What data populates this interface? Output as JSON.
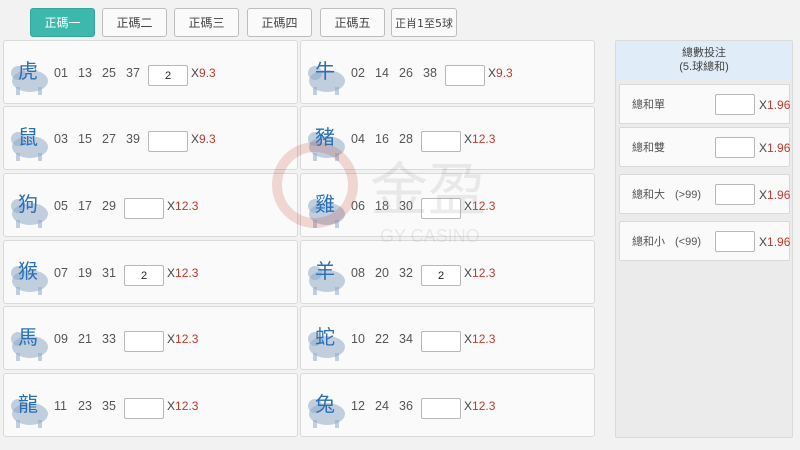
{
  "tabs": [
    {
      "label": "正碼一",
      "active": true
    },
    {
      "label": "正碼二",
      "active": false
    },
    {
      "label": "正碼三",
      "active": false
    },
    {
      "label": "正碼四",
      "active": false
    },
    {
      "label": "正碼五",
      "active": false
    },
    {
      "label": "正肖1至5球",
      "active": false
    }
  ],
  "left_column": [
    {
      "animal": "虎",
      "icon": "tiger-icon",
      "numbers": [
        "01",
        "13",
        "25",
        "37"
      ],
      "bet": "2",
      "odds_prefix": "X",
      "odds": "9.3"
    },
    {
      "animal": "鼠",
      "icon": "rat-icon",
      "numbers": [
        "03",
        "15",
        "27",
        "39"
      ],
      "bet": "",
      "odds_prefix": "X",
      "odds": "9.3"
    },
    {
      "animal": "狗",
      "icon": "dog-icon",
      "numbers": [
        "05",
        "17",
        "29"
      ],
      "bet": "",
      "odds_prefix": "X",
      "odds": "12.3"
    },
    {
      "animal": "猴",
      "icon": "monkey-icon",
      "numbers": [
        "07",
        "19",
        "31"
      ],
      "bet": "2",
      "odds_prefix": "X",
      "odds": "12.3"
    },
    {
      "animal": "馬",
      "icon": "horse-icon",
      "numbers": [
        "09",
        "21",
        "33"
      ],
      "bet": "",
      "odds_prefix": "X",
      "odds": "12.3"
    },
    {
      "animal": "龍",
      "icon": "dragon-icon",
      "numbers": [
        "11",
        "23",
        "35"
      ],
      "bet": "",
      "odds_prefix": "X",
      "odds": "12.3"
    }
  ],
  "right_column": [
    {
      "animal": "牛",
      "icon": "ox-icon",
      "numbers": [
        "02",
        "14",
        "26",
        "38"
      ],
      "bet": "",
      "odds_prefix": "X",
      "odds": "9.3"
    },
    {
      "animal": "豬",
      "icon": "pig-icon",
      "numbers": [
        "04",
        "16",
        "28"
      ],
      "bet": "",
      "odds_prefix": "X",
      "odds": "12.3"
    },
    {
      "animal": "雞",
      "icon": "rooster-icon",
      "numbers": [
        "06",
        "18",
        "30"
      ],
      "bet": "",
      "odds_prefix": "X",
      "odds": "12.3"
    },
    {
      "animal": "羊",
      "icon": "goat-icon",
      "numbers": [
        "08",
        "20",
        "32"
      ],
      "bet": "2",
      "odds_prefix": "X",
      "odds": "12.3"
    },
    {
      "animal": "蛇",
      "icon": "snake-icon",
      "numbers": [
        "10",
        "22",
        "34"
      ],
      "bet": "",
      "odds_prefix": "X",
      "odds": "12.3"
    },
    {
      "animal": "兔",
      "icon": "rabbit-icon",
      "numbers": [
        "12",
        "24",
        "36"
      ],
      "bet": "",
      "odds_prefix": "X",
      "odds": "12.3"
    }
  ],
  "total_panel": {
    "title": "總數投注",
    "subtitle": "(5.球總和)",
    "rows": [
      {
        "label": "總和單",
        "extra": "",
        "bet": "",
        "odds_prefix": "X",
        "odds": "1.96"
      },
      {
        "label": "總和雙",
        "extra": "",
        "bet": "",
        "odds_prefix": "X",
        "odds": "1.96"
      },
      {
        "label": "總和大",
        "extra": "(>99)",
        "bet": "",
        "odds_prefix": "X",
        "odds": "1.96"
      },
      {
        "label": "總和小",
        "extra": "(<99)",
        "bet": "",
        "odds_prefix": "X",
        "odds": "1.96"
      }
    ]
  },
  "colors": {
    "accent": "#3cb8ad",
    "odds": "#c0392b",
    "animal_text": "#2a6fb5",
    "panel_header": "#e0ecf7"
  },
  "watermark": {
    "brand": "金盈",
    "sub": "GY CASINO"
  }
}
